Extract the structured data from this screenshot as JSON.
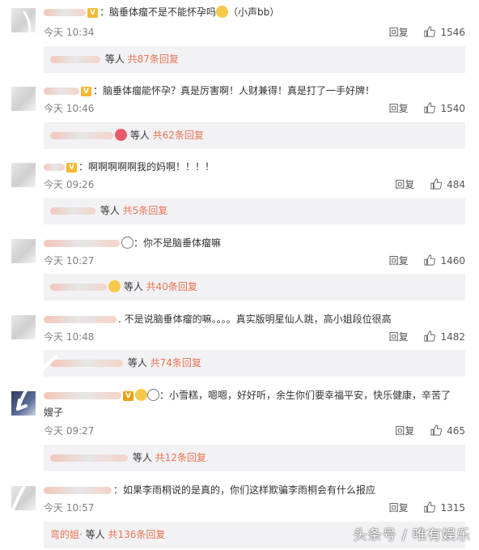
{
  "comments": [
    {
      "text": "：脑垂体瘤不是不能怀孕吗",
      "tail": "（小声bb）",
      "time": "今天 10:34",
      "reply": "回复",
      "likes": "1546",
      "sub_mid": " 等人 ",
      "sub_count": "共87条回复"
    },
    {
      "text": "：脑垂体瘤能怀孕？真是厉害啊！人财兼得！真是打了一手好牌！",
      "time": "今天 10:46",
      "reply": "回复",
      "likes": "1540",
      "sub_mid": " 等人 ",
      "sub_count": "共62条回复"
    },
    {
      "text": "：啊啊啊啊啊我的妈啊！！！！",
      "time": "今天 09:26",
      "reply": "回复",
      "likes": "484",
      "sub_mid": " 等人 ",
      "sub_count": "共5条回复"
    },
    {
      "text": "：你不是脑垂体瘤嘛",
      "time": "今天 10:27",
      "reply": "回复",
      "likes": "1460",
      "sub_mid": " 等人 ",
      "sub_count": "共40条回复"
    },
    {
      "text": ". 不是说脑垂体瘤的嘛。。。。真实版明星仙人跳，高小姐段位很高",
      "time": "今天 10:48",
      "reply": "回复",
      "likes": "1482",
      "sub_mid": " 等人 ",
      "sub_count": "共74条回复"
    },
    {
      "text": "：小雪糕，嗯嗯，好好听，余生你们要幸福平安，快乐健康，辛苦了",
      "text2": "嫂子",
      "time": "今天 09:27",
      "reply": "回复",
      "likes": "465",
      "sub_mid": " 等人 ",
      "sub_count": "共12条回复"
    },
    {
      "text": "：如果李雨桐说的是真的，你们这样欺骗李雨桐会有什么报应",
      "time": "今天 10:57",
      "reply": "回复",
      "likes": "1315",
      "sub_prefix": "弯的姐·",
      "sub_mid": " 等人 ",
      "sub_count": "共136条回复"
    }
  ],
  "watermark": "头条号 / 唯有娱乐",
  "colors": {
    "accent": "#eb7350",
    "reply_bg": "#f2f2f5",
    "meta": "#808080"
  },
  "icons": [
    "thumbs-up-icon",
    "emoji-icon",
    "vip-badge-icon",
    "avatar"
  ]
}
